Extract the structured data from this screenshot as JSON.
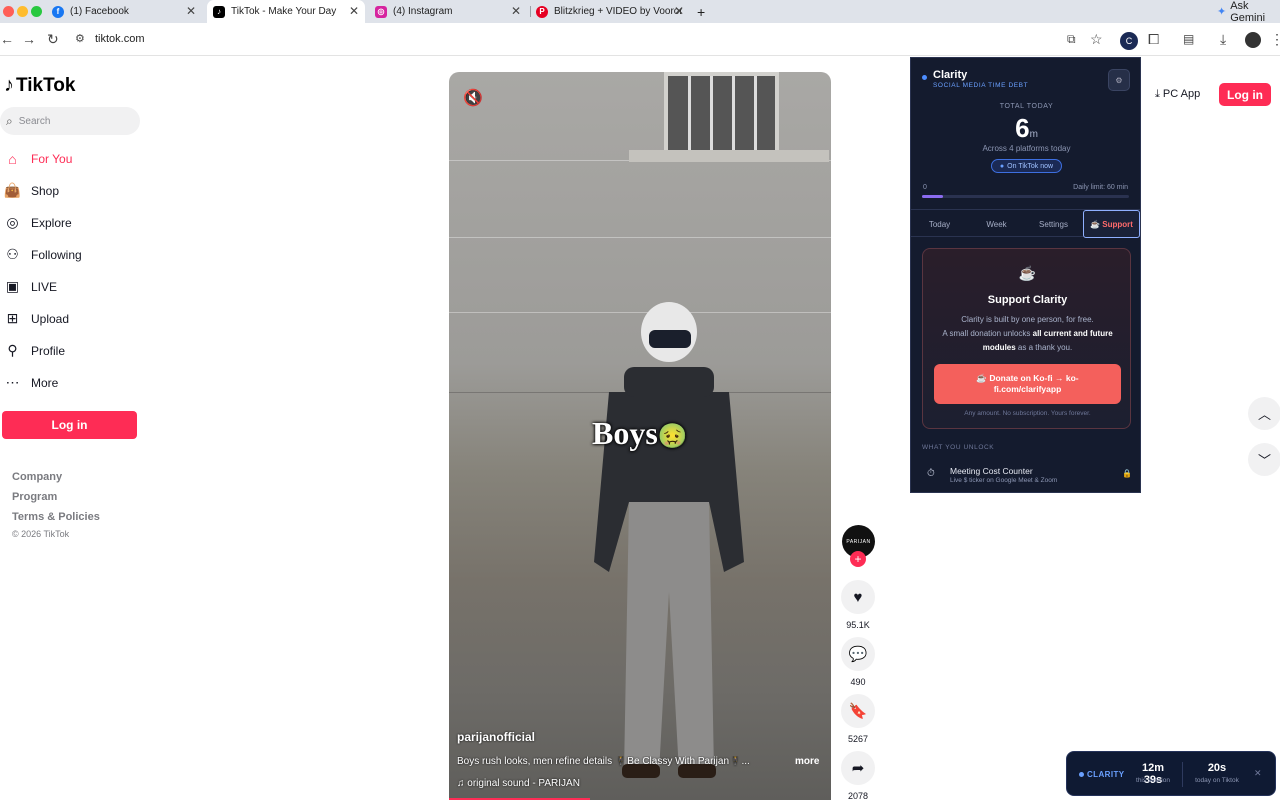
{
  "browser": {
    "tabs": [
      {
        "label": "(1) Facebook"
      },
      {
        "label": "TikTok - Make Your Day"
      },
      {
        "label": "(4) Instagram"
      },
      {
        "label": "Blitzkrieg + VIDEO by Vooron"
      }
    ],
    "gemini_label": "Ask Gemini",
    "url": "tiktok.com"
  },
  "tiktok": {
    "logo_text": "TikTok",
    "search_placeholder": "Search",
    "nav": [
      {
        "label": "For You"
      },
      {
        "label": "Shop"
      },
      {
        "label": "Explore"
      },
      {
        "label": "Following"
      },
      {
        "label": "LIVE"
      },
      {
        "label": "Upload"
      },
      {
        "label": "Profile"
      },
      {
        "label": "More"
      }
    ],
    "login_label": "Log in",
    "footer": [
      "Company",
      "Program",
      "Terms & Policies"
    ],
    "copyright": "© 2026 TikTok",
    "pc_app_label": "PC App",
    "top_login_label": "Log in",
    "video": {
      "overlay_text": "Boys",
      "username": "parijanofficial",
      "caption": "Boys rush looks, men refine details 🕴️Be Classy With Parijan🕴️...",
      "more_label": "more",
      "sound": "original sound - PARIJAN",
      "progress_fraction": 0.37
    },
    "avatar_text": "PARIJAN",
    "actions": {
      "likes": "95.1K",
      "comments": "490",
      "saves": "5267",
      "shares": "2078"
    }
  },
  "clarity": {
    "title": "Clarity",
    "subtitle": "SOCIAL MEDIA TIME DEBT",
    "total_label": "TOTAL TODAY",
    "total_value": "6",
    "total_unit": "m",
    "across_text": "Across 4 platforms today",
    "now_pill": "On TikTok now",
    "bar_zero": "0",
    "daily_limit": "Daily limit: 60 min",
    "bar_fraction": 0.1,
    "tabs": [
      "Today",
      "Week",
      "Settings",
      "☕ Support"
    ],
    "card": {
      "cup": "☕",
      "title": "Support Clarity",
      "line1": "Clarity is built by one person, for free.",
      "line2_a": "A small donation unlocks ",
      "line2_b": "all current and future modules",
      "line2_c": " as a thank you.",
      "donate_label": "☕ Donate on Ko-fi → ko-fi.com/clarifyapp",
      "fine_print": "Any amount. No subscription. Yours forever."
    },
    "unlock_heading": "WHAT YOU UNLOCK",
    "module_title": "Meeting Cost Counter",
    "module_sub": "Live $ ticker on Google Meet & Zoom",
    "accent_color": "#4d8dff",
    "donate_color": "#f4605c"
  },
  "widget": {
    "label": "CLARITY",
    "session_value": "12m 39s",
    "session_label": "this session",
    "today_value": "20s",
    "today_label": "today on Tiktok"
  },
  "colors": {
    "tiktok_red": "#fe2c55"
  }
}
